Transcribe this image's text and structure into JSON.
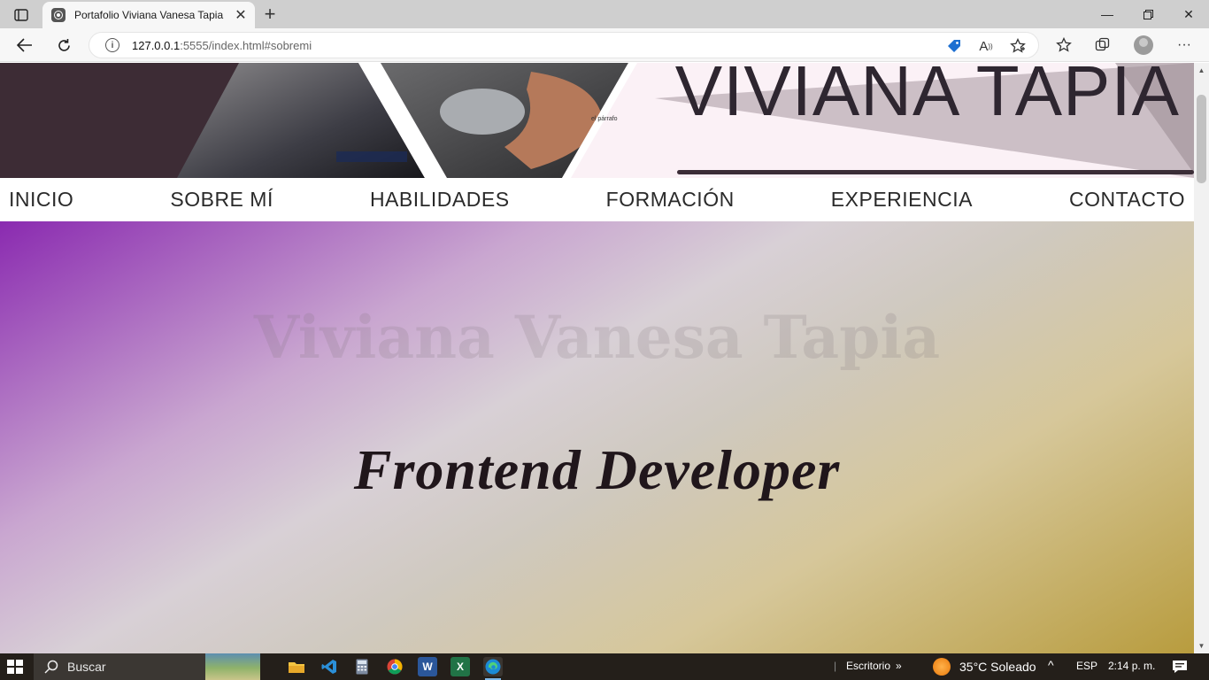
{
  "browser": {
    "tab_title": "Portafolio Viviana Vanesa Tapia",
    "url_host": "127.0.0.1",
    "url_rest": ":5555/index.html#sobremi"
  },
  "page": {
    "banner_title": "VIVIANA TAPIA",
    "banner_small": "el párrafo",
    "menu": [
      "INICIO",
      "SOBRE MÍ",
      "HABILIDADES",
      "FORMACIÓN",
      "EXPERIENCIA",
      "CONTACTO"
    ],
    "hero_name": "Viviana Vanesa Tapia",
    "hero_role": "Frontend Developer"
  },
  "taskbar": {
    "search_placeholder": "Buscar",
    "desktop_label": "Escritorio",
    "weather": "35°C  Soleado",
    "language": "ESP",
    "time": "2:14 p. m."
  },
  "colors": {
    "banner_dark": "#3d2c35",
    "hero_purple": "#8a2ab0",
    "hero_gold": "#b89c3e"
  }
}
